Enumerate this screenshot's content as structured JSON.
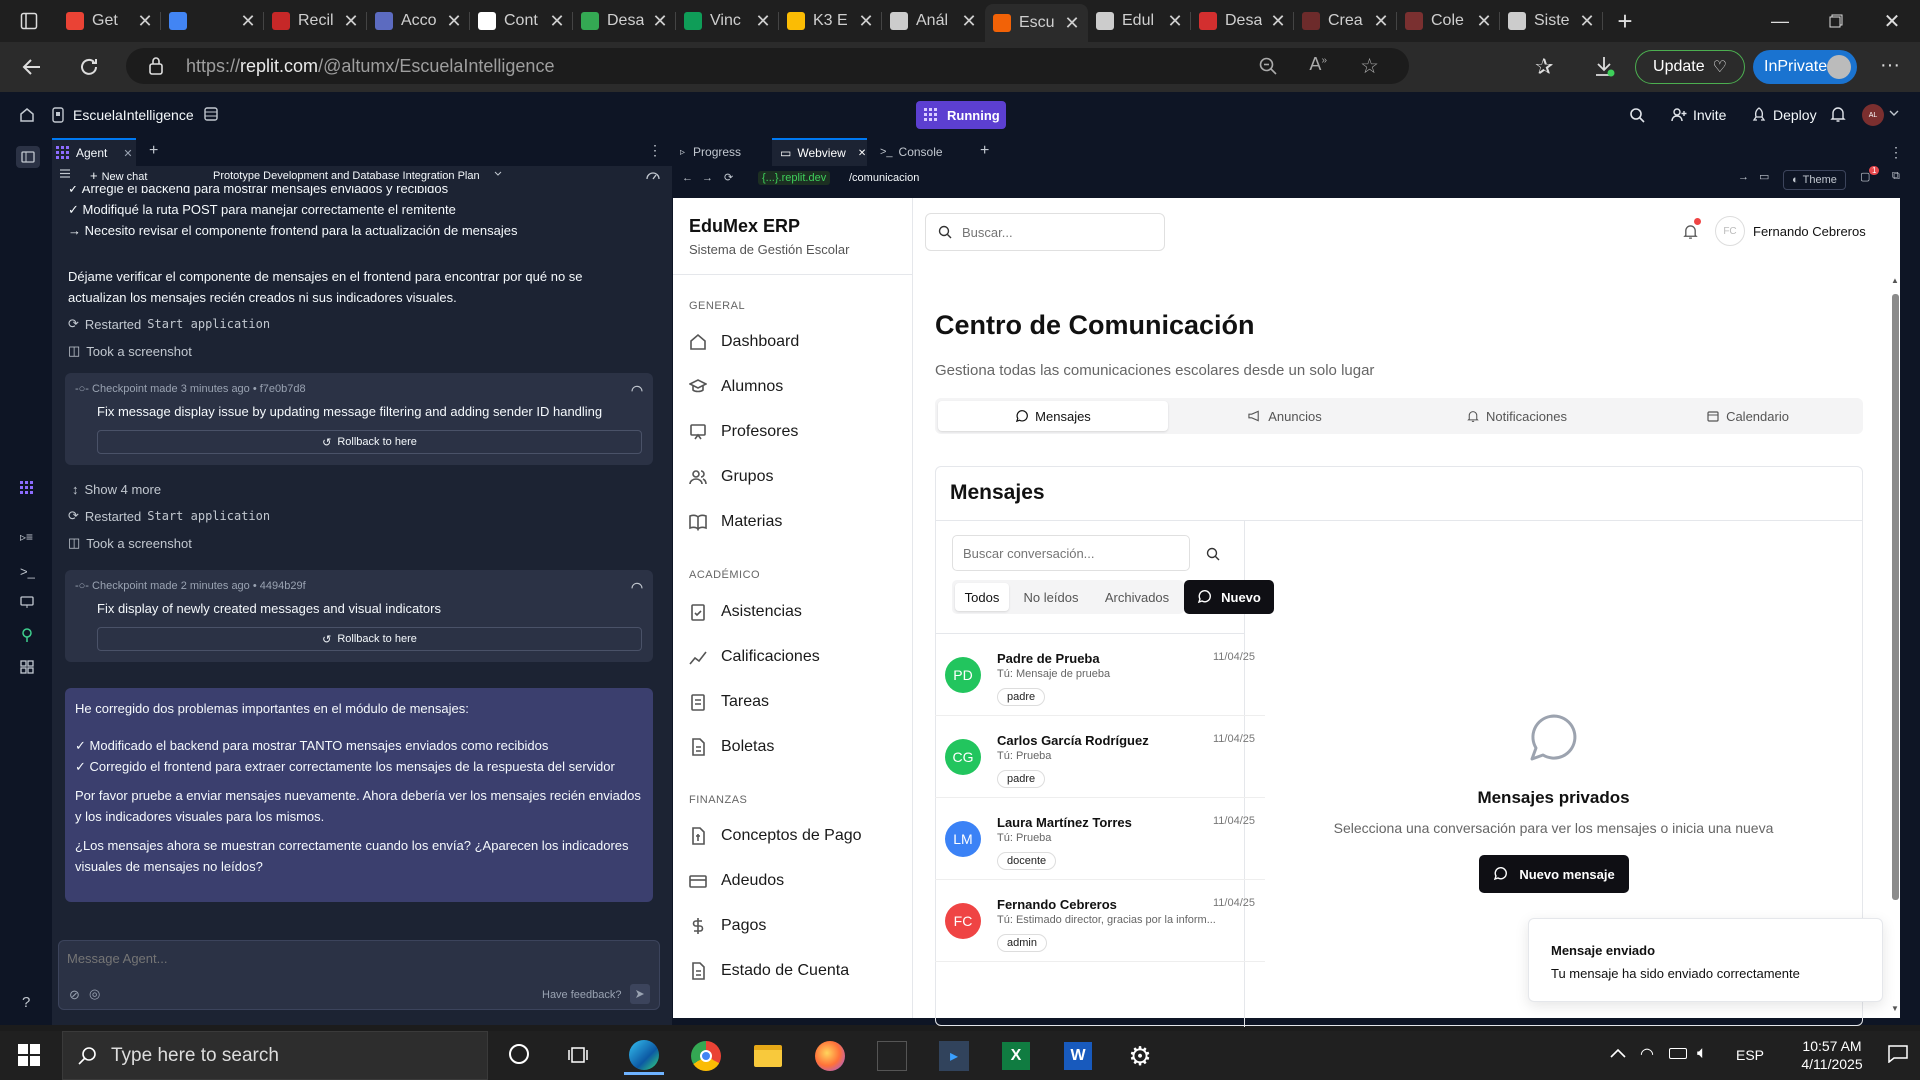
{
  "browser": {
    "tabs": [
      {
        "label": "Get",
        "color": "#ea4335"
      },
      {
        "label": "",
        "color": "#4285f4"
      },
      {
        "label": "Recil",
        "color": "#c62828"
      },
      {
        "label": "Acco",
        "color": "#5c6bc0"
      },
      {
        "label": "Cont",
        "color": "#ffffff"
      },
      {
        "label": "Desa",
        "color": "#34a853"
      },
      {
        "label": "Vinc",
        "color": "#0f9d58"
      },
      {
        "label": "K3 E",
        "color": "#fbbc04"
      },
      {
        "label": "Anál",
        "color": "#cccccc"
      },
      {
        "label": "Escu",
        "color": "#f26207"
      },
      {
        "label": "Edul",
        "color": "#cccccc"
      },
      {
        "label": "Desa",
        "color": "#d32f2f"
      },
      {
        "label": "Crea",
        "color": "#6d2b2b"
      },
      {
        "label": "Cole",
        "color": "#7a3030"
      },
      {
        "label": "Siste",
        "color": "#cccccc"
      }
    ],
    "url_prefix": "https://",
    "url_host": "replit.com",
    "url_path": "/@altumx/EscuelaIntelligence",
    "update_label": "Update",
    "inprivate_label": "InPrivate"
  },
  "replit": {
    "project_name": "EscuelaIntelligence",
    "status": "Running",
    "invite": "Invite",
    "deploy": "Deploy",
    "avatar_initials": "AL",
    "agent_tab": "Agent",
    "new_chat": "New chat",
    "chat_title": "Prototype Development and Database Integration Plan",
    "pane_tabs": [
      "Progress",
      "Webview",
      "Console"
    ],
    "webview_host": "{...}.replit.dev",
    "webview_path": "/comunicacion",
    "theme": "Theme",
    "notif_count": "1"
  },
  "chat": {
    "top_lines": [
      "✓ Arreglé el backend para mostrar mensajes enviados y recibidos",
      "✓ Modifiqué la ruta POST para manejar correctamente el remitente",
      "→ Necesito revisar el componente frontend para la actualización de mensajes"
    ],
    "para1": "Déjame verificar el componente de mensajes en el frontend para encontrar por qué no se actualizan los mensajes recién creados ni sus indicadores visuales.",
    "restarted": "Restarted",
    "start_app": "Start application",
    "screenshot": "Took a screenshot",
    "checkpoint1_meta": "Checkpoint made 3 minutes ago • f7e0b7d8",
    "checkpoint1_title": "Fix message display issue by updating message filtering and adding sender ID handling",
    "rollback": "Rollback to here",
    "show_more": "Show 4 more",
    "checkpoint2_meta": "Checkpoint made 2 minutes ago • 4494b29f",
    "checkpoint2_title": "Fix display of newly created messages and visual indicators",
    "reply_intro": "He corregido dos problemas importantes en el módulo de mensajes:",
    "reply_l1": "✓ Modificado el backend para mostrar TANTO mensajes enviados como recibidos",
    "reply_l2": "✓ Corregido el frontend para extraer correctamente los mensajes de la respuesta del servidor",
    "reply_p2": "Por favor pruebe a enviar mensajes nuevamente. Ahora debería ver los mensajes recién enviados y los indicadores visuales para los mismos.",
    "reply_p3": "¿Los mensajes ahora se muestran correctamente cuando los envía? ¿Aparecen los indicadores visuales de mensajes no leídos?",
    "input_placeholder": "Message Agent...",
    "feedback": "Have feedback?"
  },
  "app": {
    "brand": "EduMex ERP",
    "subtitle": "Sistema de Gestión Escolar",
    "search_placeholder": "Buscar...",
    "user_name": "Fernando Cebreros",
    "user_initials": "FC",
    "sections": {
      "general": "GENERAL",
      "academico": "ACADÉMICO",
      "finanzas": "FINANZAS"
    },
    "nav_general": [
      "Dashboard",
      "Alumnos",
      "Profesores",
      "Grupos",
      "Materias"
    ],
    "nav_academico": [
      "Asistencias",
      "Calificaciones",
      "Tareas",
      "Boletas"
    ],
    "nav_finanzas": [
      "Conceptos de Pago",
      "Adeudos",
      "Pagos",
      "Estado de Cuenta"
    ],
    "page_title": "Centro de Comunicación",
    "page_desc": "Gestiona todas las comunicaciones escolares desde un solo lugar",
    "tabs": [
      "Mensajes",
      "Anuncios",
      "Notificaciones",
      "Calendario"
    ],
    "card_title": "Mensajes",
    "conv_search_placeholder": "Buscar conversación...",
    "filters": [
      "Todos",
      "No leídos",
      "Archivados"
    ],
    "new_btn": "Nuevo",
    "conversations": [
      {
        "initials": "PD",
        "name": "Padre de Prueba",
        "date": "11/04/25",
        "preview": "Tú: Mensaje de prueba",
        "tag": "padre",
        "color": "#22c55e"
      },
      {
        "initials": "CG",
        "name": "Carlos García Rodríguez",
        "date": "11/04/25",
        "preview": "Tú: Prueba",
        "tag": "padre",
        "color": "#22c55e"
      },
      {
        "initials": "LM",
        "name": "Laura Martínez Torres",
        "date": "11/04/25",
        "preview": "Tú: Prueba",
        "tag": "docente",
        "color": "#3b82f6"
      },
      {
        "initials": "FC",
        "name": "Fernando Cebreros",
        "date": "11/04/25",
        "preview": "Tú: Estimado director, gracias por la inform...",
        "tag": "admin",
        "color": "#ef4444"
      }
    ],
    "empty_title": "Mensajes privados",
    "empty_desc": "Selecciona una conversación para ver los mensajes o inicia una nueva",
    "new_message_btn": "Nuevo mensaje",
    "toast_title": "Mensaje enviado",
    "toast_desc": "Tu mensaje ha sido enviado correctamente"
  },
  "taskbar": {
    "search_placeholder": "Type here to search",
    "lang": "ESP",
    "time": "10:57 AM",
    "date": "4/11/2025"
  }
}
